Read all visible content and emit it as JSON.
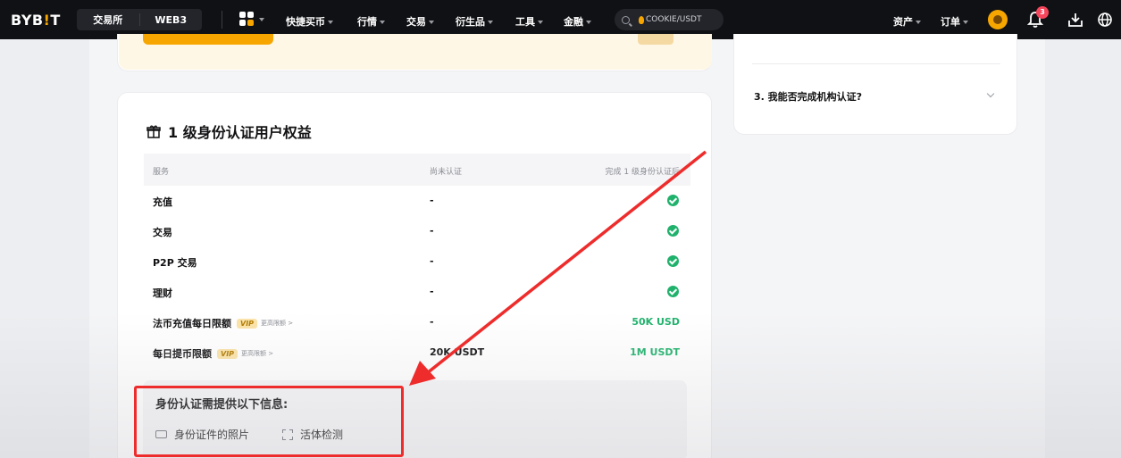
{
  "nav": {
    "logo_main": "BYB",
    "logo_bang": "!",
    "logo_end": "T",
    "tab_exchange": "交易所",
    "tab_web3": "WEB3",
    "items": [
      "快捷买币",
      "行情",
      "交易",
      "衍生品",
      "工具",
      "金融"
    ],
    "search_placeholder": "COOKIE/USDT",
    "assets": "资产",
    "orders": "订单",
    "notification_count": "3"
  },
  "faq": {
    "question3": "3. 我能否完成机构认证?"
  },
  "benefits": {
    "title": "1 级身份认证用户权益",
    "headers": {
      "service": "服务",
      "unverified": "尚未认证",
      "verified": "完成 1 级身份认证后"
    },
    "rows": [
      {
        "service": "充值",
        "unverified": "-",
        "verified": "check"
      },
      {
        "service": "交易",
        "unverified": "-",
        "verified": "check"
      },
      {
        "service": "P2P 交易",
        "unverified": "-",
        "verified": "check"
      },
      {
        "service": "理财",
        "unverified": "-",
        "verified": "check"
      },
      {
        "service": "法币充值每日限额",
        "vip": "VIP",
        "more": "更高限额 >",
        "unverified": "-",
        "verified": "50K USD"
      },
      {
        "service": "每日提币限额",
        "vip": "VIP",
        "more": "更高限额 >",
        "unverified": "20K USDT",
        "verified": "1M USDT"
      }
    ]
  },
  "requirements": {
    "title": "身份认证需提供以下信息:",
    "id_photo": "身份证件的照片",
    "liveness": "活体检测"
  },
  "colors": {
    "brand": "#f7a600",
    "success": "#20b26c",
    "annotation": "#ee2c2c"
  }
}
